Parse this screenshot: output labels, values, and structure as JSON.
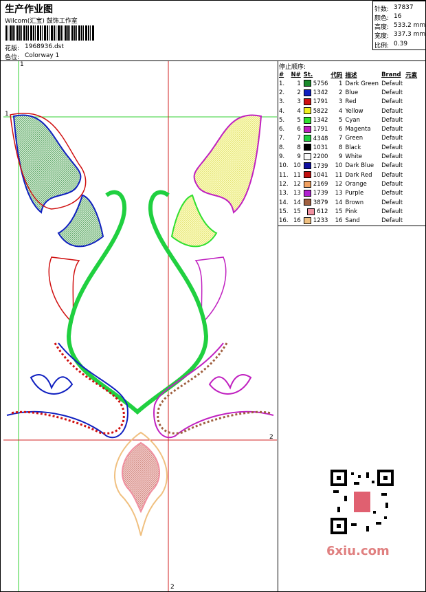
{
  "header": {
    "title": "生产作业图",
    "company": "Wilcom(汇宝) 鼓饰工作室",
    "design_label": "花版:",
    "design_file": "1968936.dst",
    "color_label": "色位:",
    "colorway": "Colorway 1"
  },
  "stats": [
    {
      "label": "针数:",
      "value": "37837"
    },
    {
      "label": "颜色:",
      "value": "16"
    },
    {
      "label": "高度:",
      "value": "533.2 mm"
    },
    {
      "label": "宽度:",
      "value": "337.3 mm"
    },
    {
      "label": "比例:",
      "value": "0.39"
    }
  ],
  "stop_sequence": {
    "title": "停止顺序:",
    "headers": [
      "#",
      "N#",
      "St.",
      "代码",
      "描述",
      "Brand",
      "元素"
    ],
    "rows": [
      [
        "1.",
        "1",
        "5756",
        "1",
        "Dark Green",
        "Default",
        "#1a8a2a"
      ],
      [
        "2.",
        "2",
        "1342",
        "2",
        "Blue",
        "Default",
        "#1020c0"
      ],
      [
        "3.",
        "3",
        "1791",
        "3",
        "Red",
        "Default",
        "#d01010"
      ],
      [
        "4.",
        "4",
        "5822",
        "4",
        "Yellow",
        "Default",
        "#f0f020"
      ],
      [
        "5.",
        "5",
        "1342",
        "5",
        "Cyan",
        "Default",
        "#30e030"
      ],
      [
        "6.",
        "6",
        "1791",
        "6",
        "Magenta",
        "Default",
        "#c020c0"
      ],
      [
        "7.",
        "7",
        "4348",
        "7",
        "Green",
        "Default",
        "#20d040"
      ],
      [
        "8.",
        "8",
        "1031",
        "8",
        "Black",
        "Default",
        "#000000"
      ],
      [
        "9.",
        "9",
        "2200",
        "9",
        "White",
        "Default",
        "#f8f8f8"
      ],
      [
        "10.",
        "10",
        "1739",
        "10",
        "Dark Blue",
        "Default",
        "#1010a0"
      ],
      [
        "11.",
        "11",
        "1041",
        "11",
        "Dark Red",
        "Default",
        "#c01010"
      ],
      [
        "12.",
        "12",
        "2169",
        "12",
        "Orange",
        "Default",
        "#f0a060"
      ],
      [
        "13.",
        "13",
        "1739",
        "13",
        "Purple",
        "Default",
        "#b020d0"
      ],
      [
        "14.",
        "14",
        "3879",
        "14",
        "Brown",
        "Default",
        "#a06040"
      ],
      [
        "15.",
        "15",
        "612",
        "15",
        "Pink",
        "Default",
        "#f090a0"
      ],
      [
        "16.",
        "16",
        "1233",
        "16",
        "Sand",
        "Default",
        "#f0c080"
      ]
    ]
  },
  "markers": {
    "m1": "1",
    "m2": "2"
  },
  "watermark": "6xiu.com"
}
